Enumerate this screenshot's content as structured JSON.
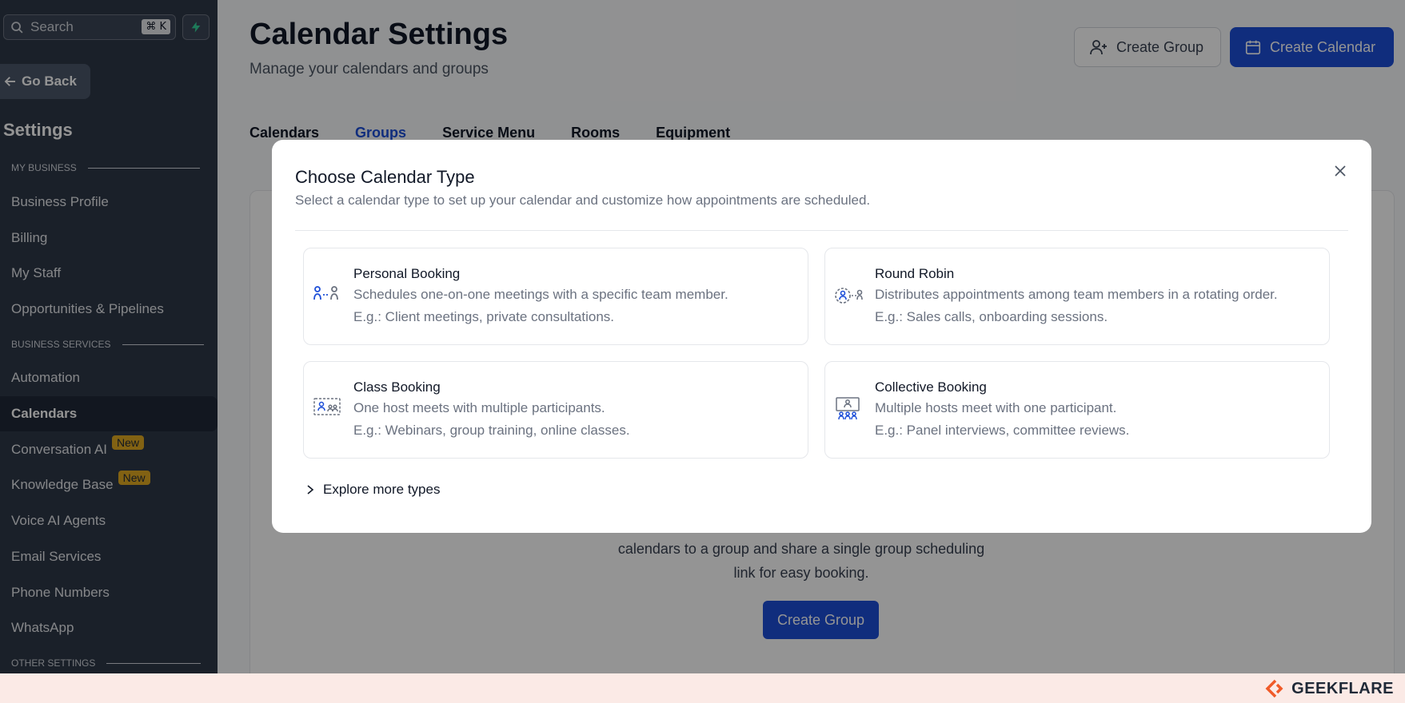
{
  "sidebar": {
    "search_placeholder": "Search",
    "search_shortcut": "⌘ K",
    "go_back": "Go Back",
    "title": "Settings",
    "sections": [
      "MY BUSINESS",
      "BUSINESS SERVICES",
      "OTHER SETTINGS"
    ],
    "my_business_items": [
      "Business Profile",
      "Billing",
      "My Staff",
      "Opportunities & Pipelines"
    ],
    "business_services_items": [
      "Automation",
      "Calendars",
      "Conversation AI",
      "Knowledge Base",
      "Voice AI Agents",
      "Email Services",
      "Phone Numbers",
      "WhatsApp"
    ],
    "badge_new": "New",
    "active_item": "Calendars"
  },
  "header": {
    "title": "Calendar Settings",
    "subtitle": "Manage your calendars and groups",
    "create_group": "Create Group",
    "create_calendar": "Create Calendar"
  },
  "tabs": [
    "Calendars",
    "Groups",
    "Service Menu",
    "Rooms",
    "Equipment"
  ],
  "active_tab": "Groups",
  "empty_state": {
    "text": "calendars to a group and share a single group scheduling link for easy booking.",
    "button": "Create Group"
  },
  "modal": {
    "title": "Choose Calendar Type",
    "subtitle": "Select a calendar type to set up your calendar and customize how appointments are scheduled.",
    "types": [
      {
        "title": "Personal Booking",
        "desc": "Schedules one-on-one meetings with a specific team member.",
        "example": "E.g.: Client meetings, private consultations.",
        "icon": "personal-booking-icon"
      },
      {
        "title": "Round Robin",
        "desc": "Distributes appointments among team members in a rotating order.",
        "example": "E.g.: Sales calls, onboarding sessions.",
        "icon": "round-robin-icon"
      },
      {
        "title": "Class Booking",
        "desc": "One host meets with multiple participants.",
        "example": "E.g.: Webinars, group training, online classes.",
        "icon": "class-booking-icon"
      },
      {
        "title": "Collective Booking",
        "desc": "Multiple hosts meet with one participant.",
        "example": "E.g.: Panel interviews, committee reviews.",
        "icon": "collective-booking-icon"
      }
    ],
    "explore": "Explore more types"
  },
  "footer": {
    "brand": "GEEKFLARE"
  },
  "colors": {
    "primary": "#1d4ed8",
    "sidebar": "#2d3748",
    "badge": "#e0a921",
    "brand": "#f05a28"
  }
}
